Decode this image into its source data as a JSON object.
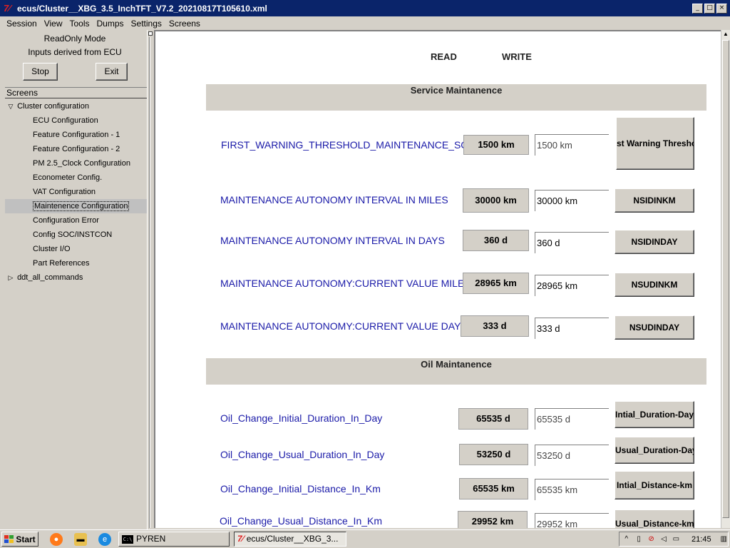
{
  "window": {
    "title": "ecus/Cluster__XBG_3.5_InchTFT_V7.2_20210817T105610.xml",
    "app_icon": "tk-feather-icon",
    "minimize_glyph": "_",
    "maximize_glyph": "□",
    "close_glyph": "×"
  },
  "menu": [
    "Session",
    "View",
    "Tools",
    "Dumps",
    "Settings",
    "Screens"
  ],
  "left": {
    "mode_line1": "ReadOnly Mode",
    "mode_line2": "Inputs derived from ECU",
    "stop_label": "Stop",
    "exit_label": "Exit",
    "screens_header": "Screens",
    "tree": {
      "root": "Cluster configuration",
      "children": [
        "ECU Configuration",
        "Feature Configuration - 1",
        "Feature Configuration - 2",
        "PM 2.5_Clock Configuration",
        "Econometer Config.",
        "VAT Configuration",
        "Maintenence Configuration",
        "Configuration Error",
        "Config SOC/INSTCON",
        "Cluster I/O",
        "Part References"
      ],
      "selected": "Maintenence Configuration",
      "root2": "ddt_all_commands",
      "expanded_glyph": "▽",
      "collapsed_glyph": "▷"
    }
  },
  "main": {
    "read_header": "READ",
    "write_header": "WRITE",
    "service_section": "Service Maintanence",
    "oil_section": "Oil Maintanence",
    "service_rows": [
      {
        "label": "FIRST_WARNING_THRESHOLD_MAINTENANCE_SCHEI",
        "read": "1500 km",
        "write": "1500 km",
        "button": "st Warning Thresho"
      },
      {
        "label": "MAINTENANCE AUTONOMY INTERVAL IN MILES",
        "read": "30000 km",
        "write": "30000 km",
        "button": "NSIDINKM"
      },
      {
        "label": "MAINTENANCE AUTONOMY INTERVAL IN DAYS",
        "read": "360 d",
        "write": "360 d",
        "button": "NSIDINDAY"
      },
      {
        "label": "MAINTENANCE AUTONOMY:CURRENT VALUE MILES",
        "read": "28965 km",
        "write": "28965 km",
        "button": "NSUDINKM"
      },
      {
        "label": "MAINTENANCE AUTONOMY:CURRENT VALUE DAYS",
        "read": "333 d",
        "write": "333 d",
        "button": "NSUDINDAY"
      }
    ],
    "oil_rows": [
      {
        "label": "Oil_Change_Initial_Duration_In_Day",
        "read": "65535 d",
        "write": "65535 d",
        "button": "Intial_Duration-Day"
      },
      {
        "label": "Oil_Change_Usual_Duration_In_Day",
        "read": "53250 d",
        "write": "53250 d",
        "button": "Usual_Duration-Day"
      },
      {
        "label": "Oil_Change_Initial_Distance_In_Km",
        "read": "65535 km",
        "write": "65535 km",
        "button": "Intial_Distance-km"
      },
      {
        "label": "Oil_Change_Usual_Distance_In_Km",
        "read": "29952 km",
        "write": "29952 km",
        "button": "Usual_Distance-km"
      }
    ]
  },
  "taskbar": {
    "start_label": "Start",
    "tasks": [
      {
        "label": "PYREN",
        "icon": "cmd-icon"
      },
      {
        "label": "ecus/Cluster__XBG_3...",
        "icon": "tk-feather-icon"
      }
    ],
    "clock": "21:45"
  },
  "colors": {
    "titlebar": "#0a246a",
    "label_blue": "#1a1aa8",
    "section_bg": "#d4d0c8"
  }
}
